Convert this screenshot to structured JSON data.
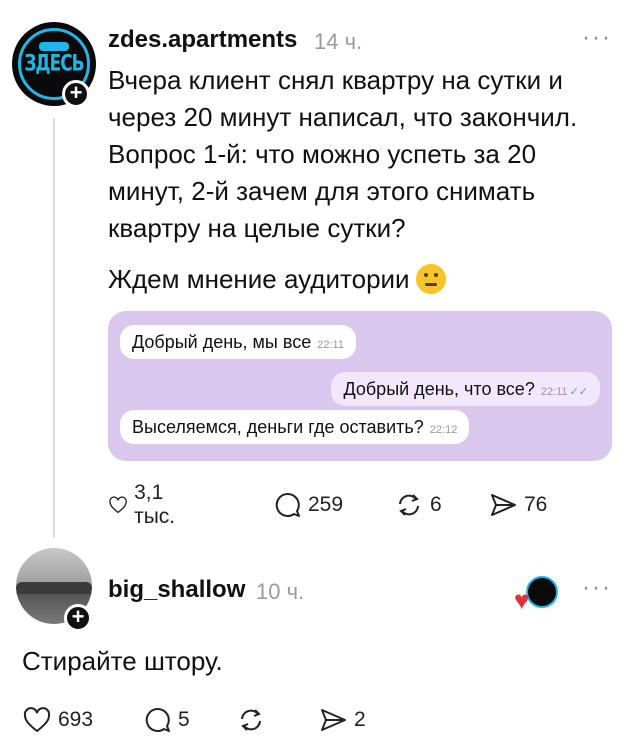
{
  "post": {
    "username": "zdes.apartments",
    "time": "14 ч.",
    "more_label": "···",
    "avatar_text": "ЗДЕСЬ",
    "text_lines": [
      "Вчера клиент снял квартру на сутки и",
      "через 20 минут написал, что закончил.",
      "Вопрос 1-й: что можно успеть за 20",
      "минут, 2-й зачем для этого снимать",
      "квартру на целые сутки?"
    ],
    "text2": "Ждем мнение аудитории",
    "emoji": "thinking-face",
    "chat": {
      "background": "#d9c7ee",
      "messages": [
        {
          "text": "Добрый день, мы все",
          "time": "22:11",
          "side": "left"
        },
        {
          "text": "Добрый день, что все?",
          "time": "22:11",
          "side": "right",
          "status": "✓✓"
        },
        {
          "text": "Выселяемся, деньги где оставить?",
          "time": "22:12",
          "side": "left"
        }
      ]
    },
    "actions": {
      "likes": "3,1 тыс.",
      "comments": "259",
      "reposts": "6",
      "shares": "76"
    }
  },
  "reply": {
    "username": "big_shallow",
    "time": "10 ч.",
    "more_label": "···",
    "text": "Стирайте штору.",
    "liked_by_author": true,
    "actions": {
      "likes": "693",
      "comments": "5",
      "reposts": "",
      "shares": "2"
    }
  },
  "colors": {
    "accent": "#22b5e8",
    "heart": "#e0323c",
    "chat_bg": "#d9c7ee"
  }
}
